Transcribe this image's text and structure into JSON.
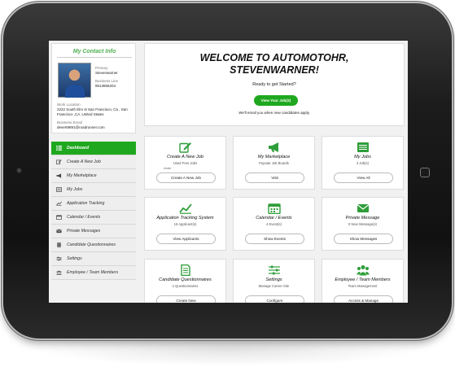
{
  "contact": {
    "title": "My Contact Info",
    "primary_label": "Primary",
    "primary_value": "Stevenwarner",
    "business_line_label": "Business Line",
    "business_line_value": "9513856204",
    "work_location_label": "Work Location",
    "work_location_line1": "2222 South Elm st San Francisco, Ca , San",
    "work_location_line2": "Francisco ,CA ,United States",
    "business_email_label": "Business Email",
    "business_email_value": "devert9891@roadrunner.com"
  },
  "menu": [
    {
      "label": "Dashboard",
      "icon": "grid-icon",
      "active": true
    },
    {
      "label": "Create A New Job",
      "icon": "pencil-icon"
    },
    {
      "label": "My Marketplace",
      "icon": "megaphone-icon"
    },
    {
      "label": "My Jobs",
      "icon": "list-icon"
    },
    {
      "label": "Application Tracking",
      "icon": "chart-icon"
    },
    {
      "label": "Calendar / Events",
      "icon": "calendar-icon"
    },
    {
      "label": "Private Messages",
      "icon": "envelope-icon"
    },
    {
      "label": "Candidate Questionnaires",
      "icon": "document-icon"
    },
    {
      "label": "Settings",
      "icon": "sliders-icon"
    },
    {
      "label": "Employee / Team Members",
      "icon": "users-icon"
    }
  ],
  "welcome": {
    "title_line1": "WELCOME TO AUTOMOTOHR,",
    "title_line2": "STEVENWARNER!",
    "ready": "Ready to get Started?",
    "button": "View Your Job(S)",
    "email_note": "We'll email you when new candidates apply."
  },
  "tiles": [
    {
      "title": "Create A New Job",
      "sub": "Used Free Jobs",
      "extra": "Under",
      "button": "Create A New Job",
      "icon": "pencil-icon"
    },
    {
      "title": "My Marketplace",
      "sub": "Popular Job Boards",
      "button": "Visit",
      "icon": "megaphone-icon"
    },
    {
      "title": "My Jobs",
      "sub": "3 Job(s)",
      "button": "View All",
      "icon": "list-icon"
    },
    {
      "title": "Application Tracking System",
      "sub": "16 Applicant(s)",
      "button": "View Applicants",
      "icon": "chart-icon"
    },
    {
      "title": "Calendar / Events",
      "sub": "4 Event(s)",
      "button": "Show Events",
      "icon": "calendar-icon"
    },
    {
      "title": "Private Message",
      "sub": "0 New Message(s)",
      "button": "Show Messages",
      "icon": "envelope-icon"
    },
    {
      "title": "Candidate Questionnaires",
      "sub": "2 Questionnaires",
      "button": "Create New",
      "icon": "document-icon"
    },
    {
      "title": "Settings",
      "sub": "Manage Career Site",
      "button": "Configure",
      "icon": "sliders-icon"
    },
    {
      "title": "Employee / Team Members",
      "sub": "Team Management",
      "button": "Access & Manage",
      "icon": "users-icon"
    }
  ],
  "colors": {
    "accent": "#1fa81f",
    "title_green": "#4caf50"
  }
}
